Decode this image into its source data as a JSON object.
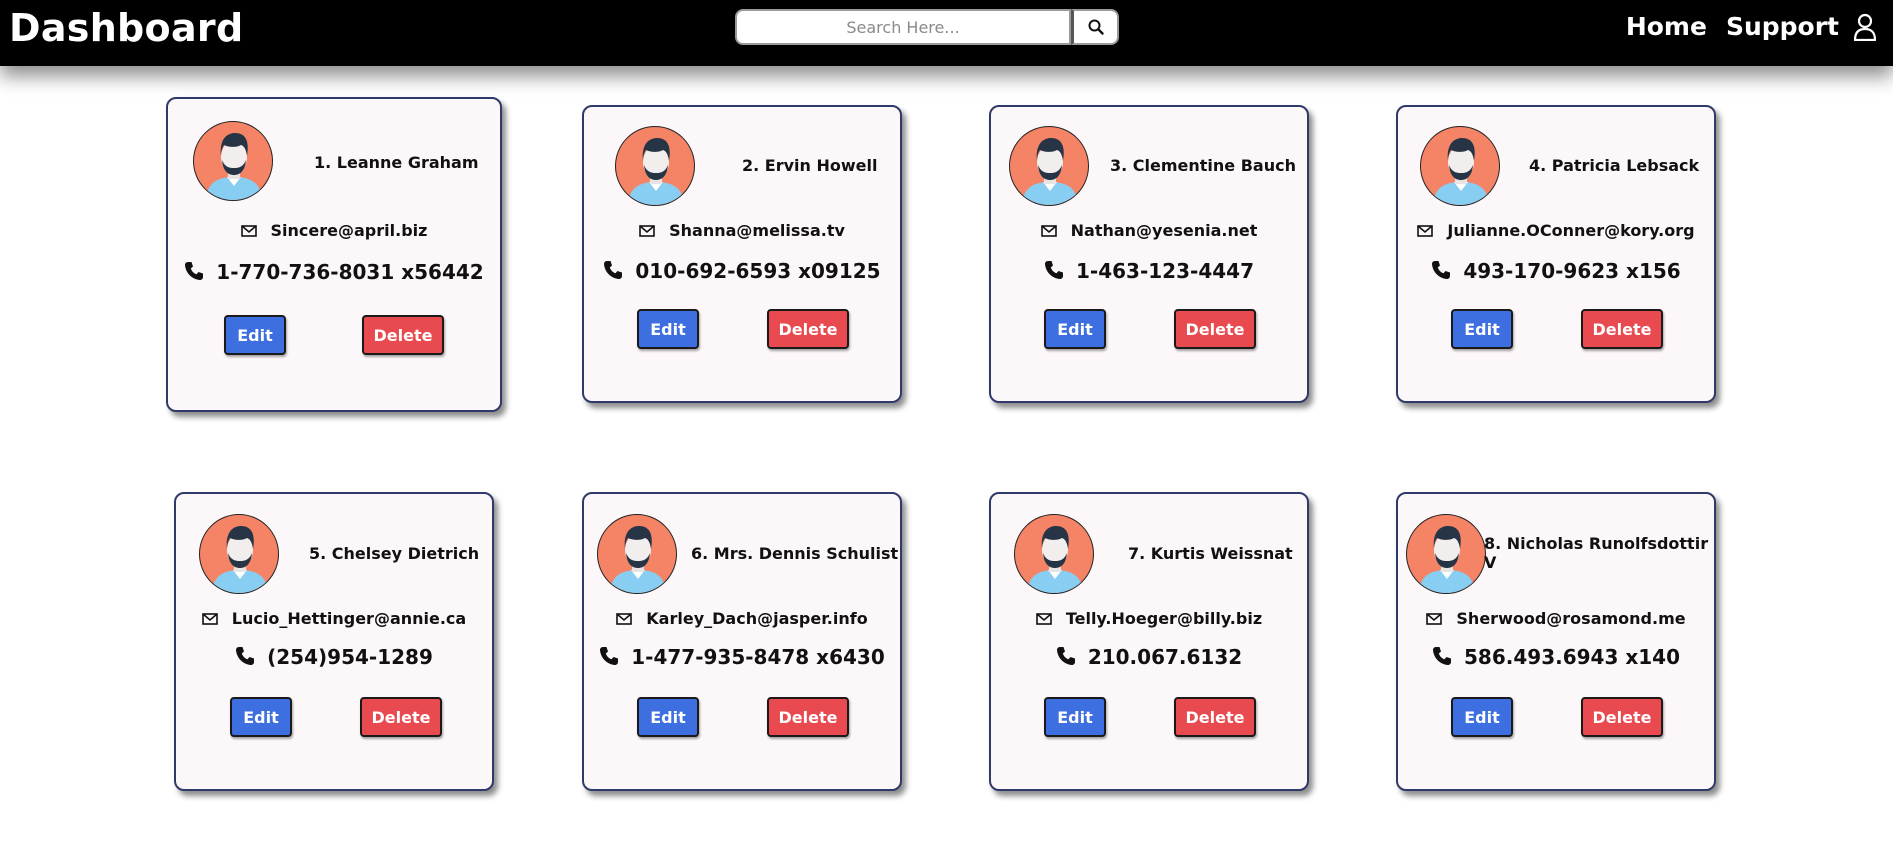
{
  "header": {
    "title": "Dashboard",
    "search": {
      "placeholder": "Search Here...",
      "value": ""
    },
    "nav": [
      {
        "label": "Home"
      },
      {
        "label": "Support"
      }
    ]
  },
  "card_actions": {
    "edit_label": "Edit",
    "delete_label": "Delete"
  },
  "users": [
    {
      "name": "1. Leanne Graham",
      "email": "Sincere@april.biz",
      "phone": "1-770-736-8031 x56442"
    },
    {
      "name": "2. Ervin Howell",
      "email": "Shanna@melissa.tv",
      "phone": "010-692-6593 x09125"
    },
    {
      "name": "3. Clementine Bauch",
      "email": "Nathan@yesenia.net",
      "phone": "1-463-123-4447"
    },
    {
      "name": "4. Patricia Lebsack",
      "email": "Julianne.OConner@kory.org",
      "phone": "493-170-9623 x156"
    },
    {
      "name": "5. Chelsey Dietrich",
      "email": "Lucio_Hettinger@annie.ca",
      "phone": "(254)954-1289"
    },
    {
      "name": "6. Mrs. Dennis Schulist",
      "email": "Karley_Dach@jasper.info",
      "phone": "1-477-935-8478 x6430"
    },
    {
      "name": "7. Kurtis Weissnat",
      "email": "Telly.Hoeger@billy.biz",
      "phone": "210.067.6132"
    },
    {
      "name": "8. Nicholas Runolfsdottir V",
      "email": "Sherwood@rosamond.me",
      "phone": "586.493.6943 x140"
    }
  ],
  "icons": {
    "search": "search-icon",
    "user": "user-icon",
    "avatar": "avatar-icon",
    "email": "envelope-icon",
    "phone": "phone-icon"
  },
  "colors": {
    "header_bg": "#000000",
    "card_bg": "#fcf7f8",
    "card_border": "#2f3a6b",
    "avatar_bg": "#f58466",
    "edit_button": "#3d6fe0",
    "delete_button": "#e84a4f"
  }
}
